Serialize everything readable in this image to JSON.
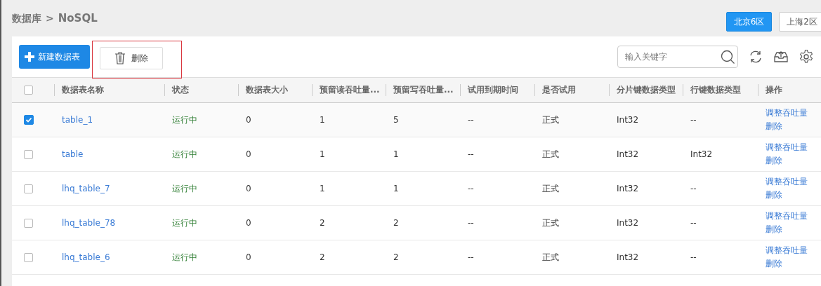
{
  "breadcrumb": {
    "parent": "数据库",
    "separator": ">",
    "current": "NoSQL"
  },
  "regions": [
    {
      "label": "北京6区",
      "selected": true
    },
    {
      "label": "上海2区",
      "selected": false
    }
  ],
  "toolbar": {
    "create_button": "新建数据表",
    "delete_button": "删除",
    "delete_highlighted": true,
    "search": {
      "placeholder": "输入关键字"
    }
  },
  "table": {
    "select_all_checked": false,
    "columns": [
      "数据表名称",
      "状态",
      "数据表大小",
      "预留读吞吐量...",
      "预留写吞吐量...",
      "试用到期时间",
      "是否试用",
      "分片键数据类型",
      "行键数据类型",
      "操作"
    ],
    "rows": [
      {
        "checked": true,
        "cells": [
          "table_1",
          "运行中",
          "0",
          "1",
          "5",
          "--",
          "正式",
          "Int32",
          "--"
        ],
        "actions": [
          "调整吞吐量",
          "删除"
        ]
      },
      {
        "checked": false,
        "cells": [
          "table",
          "运行中",
          "0",
          "1",
          "1",
          "--",
          "正式",
          "Int32",
          "Int32"
        ],
        "actions": [
          "调整吞吐量",
          "删除"
        ]
      },
      {
        "checked": false,
        "cells": [
          "lhq_table_7",
          "运行中",
          "0",
          "1",
          "1",
          "--",
          "正式",
          "Int32",
          "--"
        ],
        "actions": [
          "调整吞吐量",
          "删除"
        ]
      },
      {
        "checked": false,
        "cells": [
          "lhq_table_78",
          "运行中",
          "0",
          "2",
          "2",
          "--",
          "正式",
          "Int32",
          "--"
        ],
        "actions": [
          "调整吞吐量",
          "删除"
        ]
      },
      {
        "checked": false,
        "cells": [
          "lhq_table_6",
          "运行中",
          "0",
          "2",
          "2",
          "--",
          "正式",
          "Int32",
          "--"
        ],
        "actions": [
          "调整吞吐量",
          "删除"
        ]
      }
    ]
  }
}
